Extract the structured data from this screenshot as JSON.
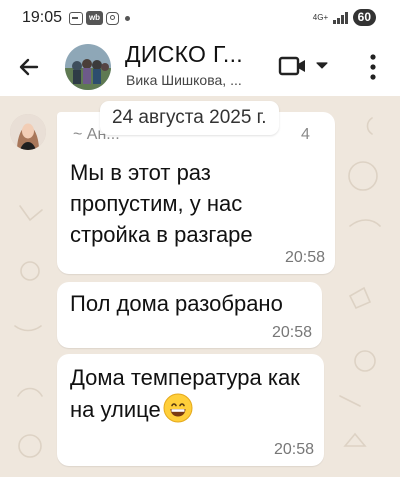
{
  "status_bar": {
    "time": "19:05",
    "network": "4G+",
    "battery": "60",
    "icons": [
      "message-icon",
      "wb-app-icon",
      "instagram-icon",
      "notification-dot-icon",
      "signal-icon",
      "battery-icon"
    ]
  },
  "header": {
    "title": "ДИСКО Г...",
    "subtitle": "Вика Шишкова, ...",
    "icons": [
      "back-arrow-icon",
      "group-avatar",
      "video-call-icon",
      "dropdown-caret-icon",
      "more-vert-icon"
    ]
  },
  "chat": {
    "date_chip": "24 августа 2025 г.",
    "messages": [
      {
        "sender_name": "~ Ан...",
        "sender_phone_fragment": "4",
        "text": "Мы в этот раз пропустим, у нас стройка в разгаре",
        "time": "20:58"
      },
      {
        "text": "Пол дома разобрано",
        "time": "20:58"
      },
      {
        "text": "Дома температура как на улице",
        "emoji": "grinning-face-emoji",
        "time": "20:58"
      }
    ]
  },
  "colors": {
    "chat_background": "#efe7dd",
    "bubble": "#ffffff",
    "header": "#ffffff"
  }
}
